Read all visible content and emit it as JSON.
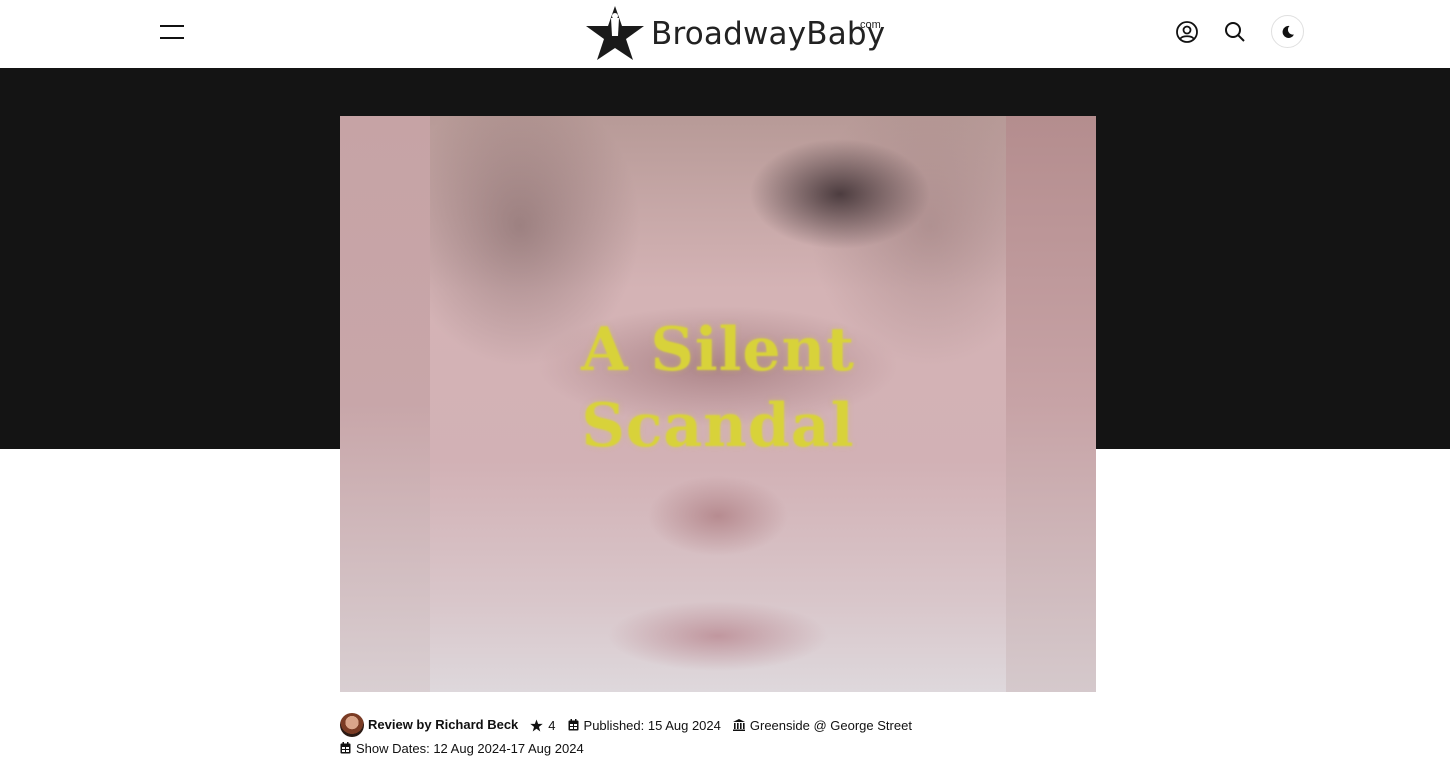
{
  "header": {
    "logo_text": "BroadwayBaby",
    "logo_suffix": ".com",
    "icons": [
      "menu-icon",
      "user-icon",
      "search-icon",
      "moon-icon"
    ]
  },
  "hero": {
    "poster_title_line1": "A Silent",
    "poster_title_line2": "Scandal",
    "colors": {
      "band": "#141414",
      "title": "#d8d23a"
    }
  },
  "review": {
    "author_label": "Review by Richard Beck",
    "rating": "4",
    "published": "Published: 15 Aug 2024",
    "venue": "Greenside @ George Street",
    "show_dates": "Show Dates: 12 Aug 2024-17 Aug 2024"
  }
}
